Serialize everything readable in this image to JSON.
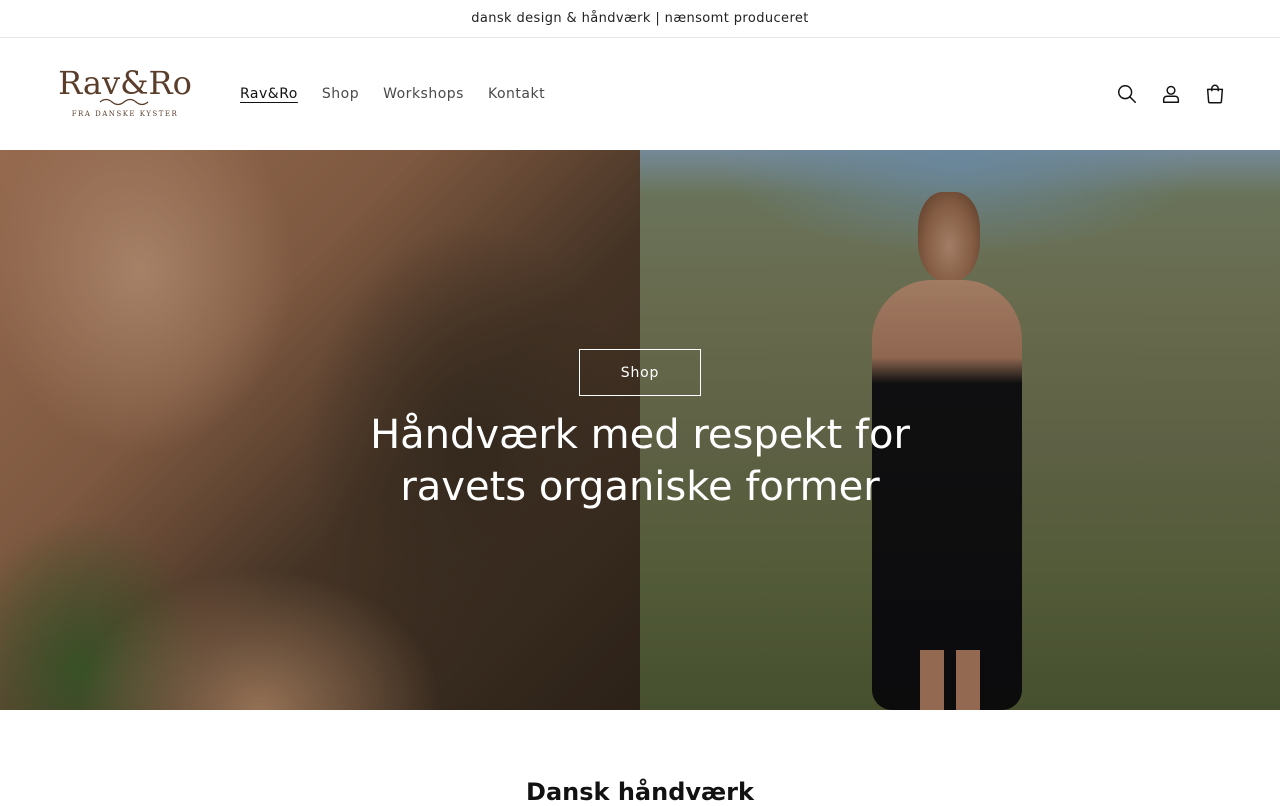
{
  "announcement": {
    "text": "dansk design & håndværk | nænsomt produceret"
  },
  "header": {
    "logo_text": "Rav&Ro",
    "logo_tagline": "FRA DANSKE KYSTER",
    "nav": [
      {
        "label": "Rav&Ro",
        "active": true
      },
      {
        "label": "Shop",
        "active": false
      },
      {
        "label": "Workshops",
        "active": false
      },
      {
        "label": "Kontakt",
        "active": false
      }
    ],
    "icons": [
      "search-icon",
      "account-icon",
      "cart-icon"
    ]
  },
  "hero": {
    "button_label": "Shop",
    "heading": "Håndværk med respekt for ravets organiske former"
  },
  "section": {
    "title": "Dansk håndværk"
  },
  "colors": {
    "logo_brown": "#5a3d2b",
    "text": "#121212",
    "nav_muted": "#4a4a4a"
  }
}
